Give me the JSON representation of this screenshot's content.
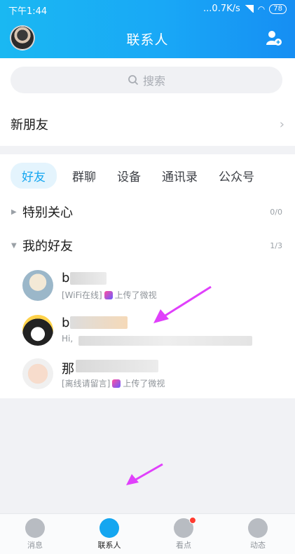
{
  "status": {
    "time": "下午1:44",
    "network": "...0.7K/s",
    "battery": "78"
  },
  "header": {
    "title": "联系人"
  },
  "search": {
    "placeholder": "搜索"
  },
  "new_friends": {
    "label": "新朋友"
  },
  "tabs": [
    {
      "label": "好友",
      "active": true
    },
    {
      "label": "群聊"
    },
    {
      "label": "设备"
    },
    {
      "label": "通讯录"
    },
    {
      "label": "公众号"
    }
  ],
  "groups": [
    {
      "name": "特别关心",
      "count": "0/0",
      "expanded": false
    },
    {
      "name": "我的好友",
      "count": "1/3",
      "expanded": true
    }
  ],
  "friends": [
    {
      "name": "b",
      "status": "[WiFi在线]",
      "activity": "上传了微视"
    },
    {
      "name": "b",
      "status": "Hi, ",
      "activity": ""
    },
    {
      "name": "那",
      "status": "[离线请留言]",
      "activity": "上传了微视"
    }
  ],
  "bottom_nav": [
    {
      "label": "消息"
    },
    {
      "label": "联系人",
      "active": true
    },
    {
      "label": "看点"
    },
    {
      "label": "动态"
    }
  ],
  "colors": {
    "accent": "#14a6f0",
    "header_start": "#1ab8f2",
    "header_end": "#168ef3",
    "annotation_arrow": "#e040fb"
  }
}
